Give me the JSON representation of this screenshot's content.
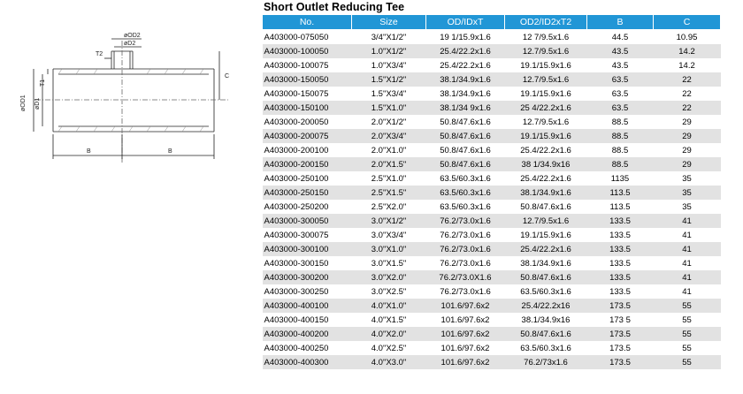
{
  "title": "Short Outlet Reducing Tee",
  "table": {
    "headers": [
      "No.",
      "Size",
      "OD/IDxT",
      "OD2/ID2xT2",
      "B",
      "C"
    ],
    "rows": [
      [
        "A403000-075050",
        "3/4\"X1/2\"",
        "19 1/15.9x1.6",
        "12 7/9.5x1.6",
        "44.5",
        "10.95"
      ],
      [
        "A403000-100050",
        "1.0\"X1/2\"",
        "25.4/22.2x1.6",
        "12.7/9.5x1.6",
        "43.5",
        "14.2"
      ],
      [
        "A403000-100075",
        "1.0\"X3/4\"",
        "25.4/22.2x1.6",
        "19.1/15.9x1.6",
        "43.5",
        "14.2"
      ],
      [
        "A403000-150050",
        "1.5\"X1/2\"",
        "38.1/34.9x1.6",
        "12.7/9.5x1.6",
        "63.5",
        "22"
      ],
      [
        "A403000-150075",
        "1.5\"X3/4\"",
        "38.1/34.9x1.6",
        "19.1/15.9x1.6",
        "63.5",
        "22"
      ],
      [
        "A403000-150100",
        "1.5\"X1.0\"",
        "38.1/34 9x1.6",
        "25 4/22.2x1.6",
        "63.5",
        "22"
      ],
      [
        "A403000-200050",
        "2.0\"X1/2\"",
        "50.8/47.6x1.6",
        "12.7/9.5x1.6",
        "88.5",
        "29"
      ],
      [
        "A403000-200075",
        "2.0\"X3/4\"",
        "50.8/47.6x1.6",
        "19.1/15.9x1.6",
        "88.5",
        "29"
      ],
      [
        "A403000-200100",
        "2.0\"X1.0\"",
        "50.8/47.6x1.6",
        "25.4/22.2x1.6",
        "88.5",
        "29"
      ],
      [
        "A403000-200150",
        "2.0\"X1.5\"",
        "50.8/47.6x1.6",
        "38 1/34.9x16",
        "88.5",
        "29"
      ],
      [
        "A403000-250100",
        "2.5\"X1.0\"",
        "63.5/60.3x1.6",
        "25.4/22.2x1.6",
        "1135",
        "35"
      ],
      [
        "A403000-250150",
        "2.5\"X1.5\"",
        "63.5/60.3x1.6",
        "38.1/34.9x1.6",
        "113.5",
        "35"
      ],
      [
        "A403000-250200",
        "2.5\"X2.0\"",
        "63.5/60.3x1.6",
        "50.8/47.6x1.6",
        "113.5",
        "35"
      ],
      [
        "A403000-300050",
        "3.0\"X1/2\"",
        "76.2/73.0x1.6",
        "12.7/9.5x1.6",
        "133.5",
        "41"
      ],
      [
        "A403000-300075",
        "3.0\"X3/4\"",
        "76.2/73.0x1.6",
        "19.1/15.9x1.6",
        "133.5",
        "41"
      ],
      [
        "A403000-300100",
        "3.0\"X1.0\"",
        "76.2/73.0x1.6",
        "25.4/22.2x1.6",
        "133.5",
        "41"
      ],
      [
        "A403000-300150",
        "3.0\"X1.5\"",
        "76.2/73.0x1.6",
        "38.1/34.9x1.6",
        "133.5",
        "41"
      ],
      [
        "A403000-300200",
        "3.0\"X2.0\"",
        "76.2/73.0X1.6",
        "50.8/47.6x1.6",
        "133.5",
        "41"
      ],
      [
        "A403000-300250",
        "3.0\"X2.5\"",
        "76.2/73.0x1.6",
        "63.5/60.3x1.6",
        "133.5",
        "41"
      ],
      [
        "A403000-400100",
        "4.0\"X1.0\"",
        "101.6/97.6x2",
        "25.4/22.2x16",
        "173.5",
        "55"
      ],
      [
        "A403000-400150",
        "4.0\"X1.5\"",
        "101.6/97.6x2",
        "38.1/34.9x16",
        "173 5",
        "55"
      ],
      [
        "A403000-400200",
        "4.0\"X2.0\"",
        "101.6/97.6x2",
        "50.8/47.6x1.6",
        "173.5",
        "55"
      ],
      [
        "A403000-400250",
        "4.0\"X2.5\"",
        "101.6/97.6x2",
        "63.5/60.3x1.6",
        "173.5",
        "55"
      ],
      [
        "A403000-400300",
        "4.0\"X3.0\"",
        "101.6/97.6x2",
        "76.2/73x1.6",
        "173.5",
        "55"
      ]
    ]
  },
  "drawing": {
    "labels": {
      "od2": "øOD2",
      "d2": "øD2",
      "t2": "T2",
      "t1": "T1",
      "od1": "øOD1",
      "d1": "øD1",
      "c": "C",
      "b_left": "B",
      "b_right": "B"
    }
  }
}
